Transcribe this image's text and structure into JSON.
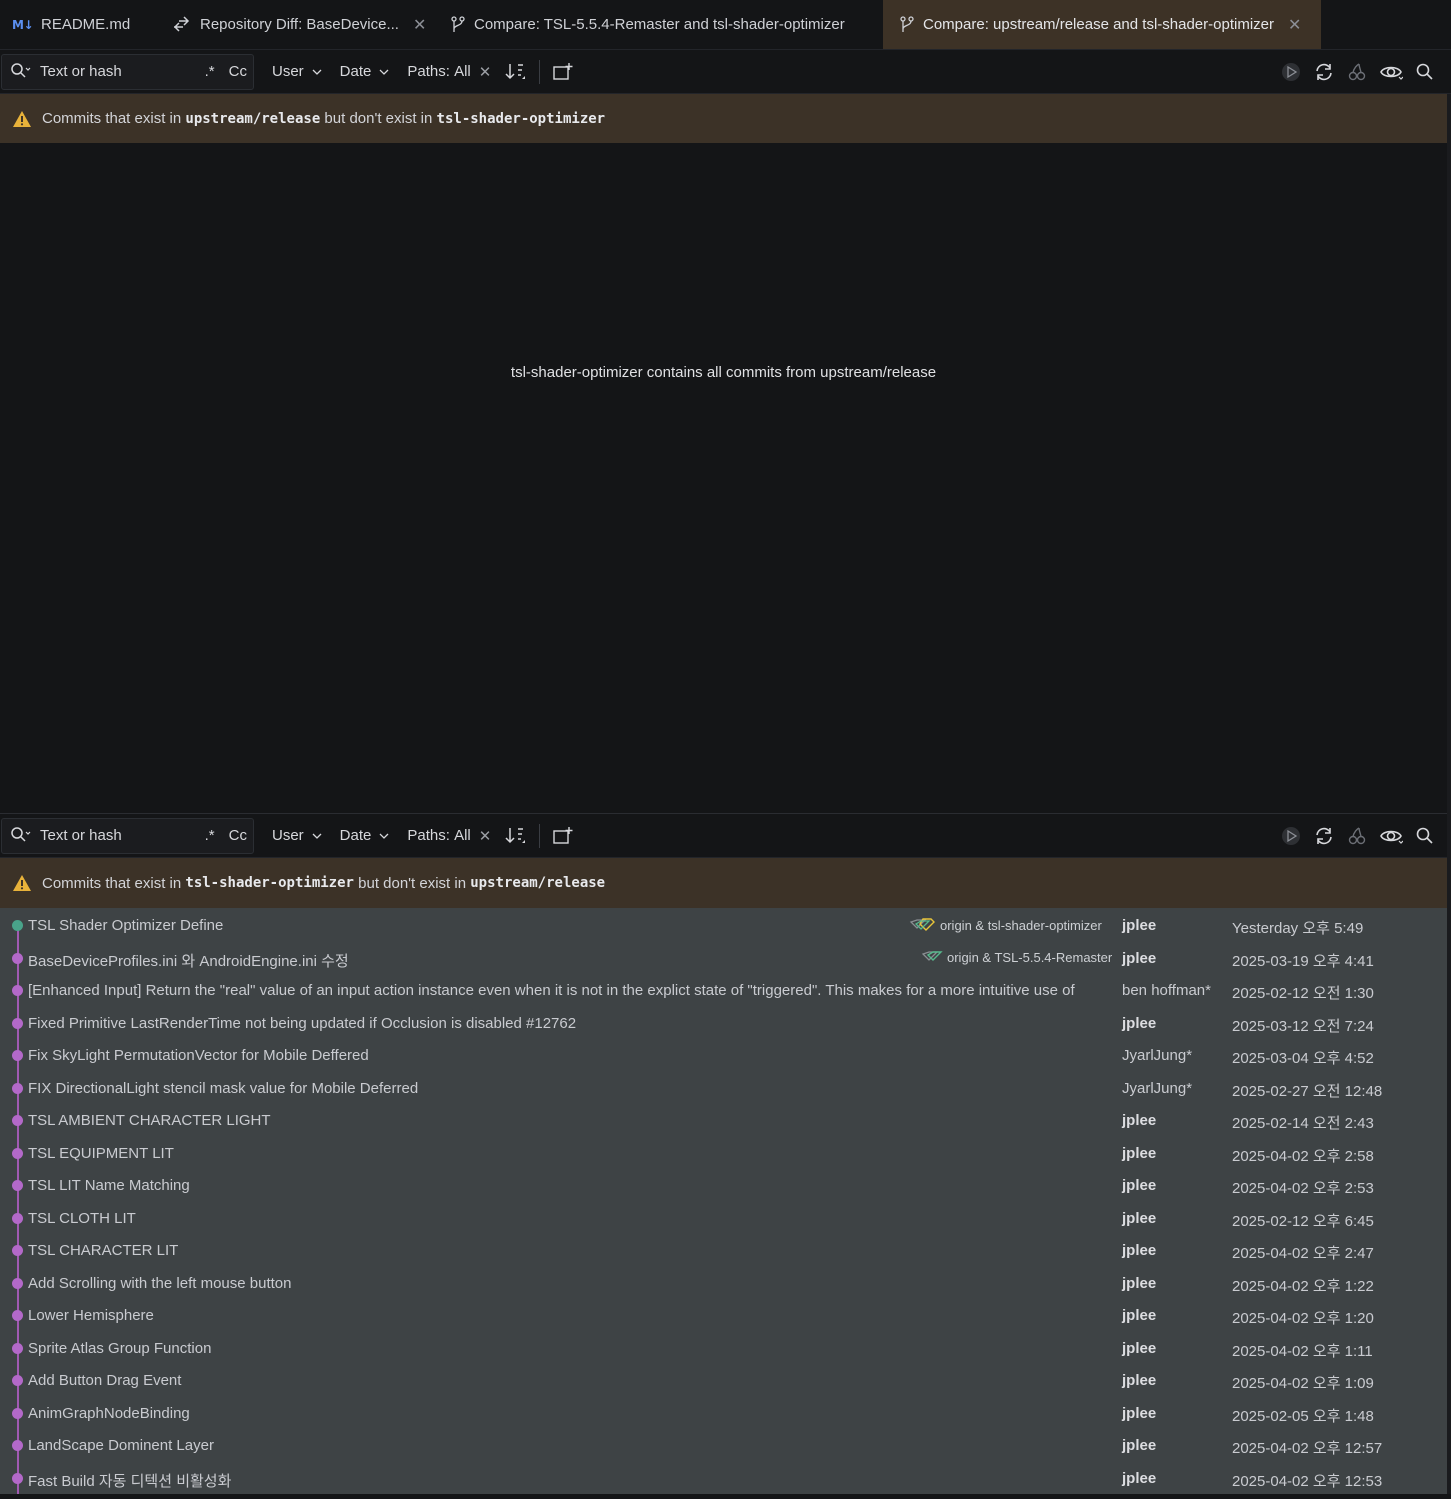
{
  "tabs": [
    {
      "label": "README.md",
      "icon": "markdown-icon",
      "closable": false,
      "active": false
    },
    {
      "label": "Repository Diff: BaseDevice...",
      "icon": "diff-icon",
      "closable": true,
      "active": false
    },
    {
      "label": "Compare: TSL-5.5.4-Remaster and tsl-shader-optimizer",
      "icon": "branch-icon",
      "closable": false,
      "active": false
    },
    {
      "label": "Compare: upstream/release and tsl-shader-optimizer",
      "icon": "branch-icon",
      "closable": true,
      "active": true
    }
  ],
  "markdown_badge": "M↓",
  "toolbar": {
    "search_placeholder": "Text or hash",
    "regex_label": ".*",
    "case_label": "Cc",
    "user_label": "User",
    "date_label": "Date",
    "paths_label": "Paths:",
    "paths_value": "All"
  },
  "top_panel": {
    "banner_prefix": "Commits that exist in",
    "banner_branch_a": "upstream/release",
    "banner_middle": "but don't exist in",
    "banner_branch_b": "tsl-shader-optimizer",
    "empty_message": "tsl-shader-optimizer contains all commits from upstream/release"
  },
  "bottom_panel": {
    "banner_prefix": "Commits that exist in",
    "banner_branch_a": "tsl-shader-optimizer",
    "banner_middle": "but don't exist in",
    "banner_branch_b": "upstream/release",
    "commits": [
      {
        "subject": "TSL Shader Optimizer Define",
        "refs": "origin & tsl-shader-optimizer",
        "author": "jplee",
        "date": "Yesterday 오후 5:49"
      },
      {
        "subject": "BaseDeviceProfiles.ini 와 AndroidEngine.ini 수정",
        "refs": "origin & TSL-5.5.4-Remaster",
        "author": "jplee",
        "date": "2025-03-19 오후 4:41"
      },
      {
        "subject": "[Enhanced Input] Return the \"real\" value of an input action instance even when it is not in the explict state of \"triggered\". This makes for a more intuitive use of",
        "refs": "",
        "author": "ben hoffman*",
        "date": "2025-02-12 오전 1:30"
      },
      {
        "subject": "Fixed Primitive LastRenderTime not being updated if Occlusion is disabled #12762",
        "refs": "",
        "author": "jplee",
        "date": "2025-03-12 오전 7:24"
      },
      {
        "subject": "Fix SkyLight PermutationVector for Mobile Deffered",
        "refs": "",
        "author": "JyarlJung*",
        "date": "2025-03-04 오후 4:52"
      },
      {
        "subject": "FIX DirectionalLight stencil mask value for Mobile Deferred",
        "refs": "",
        "author": "JyarlJung*",
        "date": "2025-02-27 오전 12:48"
      },
      {
        "subject": "TSL AMBIENT CHARACTER LIGHT",
        "refs": "",
        "author": "jplee",
        "date": "2025-02-14 오전 2:43"
      },
      {
        "subject": "TSL EQUIPMENT LIT",
        "refs": "",
        "author": "jplee",
        "date": "2025-04-02 오후 2:58"
      },
      {
        "subject": "TSL LIT Name Matching",
        "refs": "",
        "author": "jplee",
        "date": "2025-04-02 오후 2:53"
      },
      {
        "subject": "TSL CLOTH LIT",
        "refs": "",
        "author": "jplee",
        "date": "2025-02-12 오후 6:45"
      },
      {
        "subject": "TSL CHARACTER LIT",
        "refs": "",
        "author": "jplee",
        "date": "2025-04-02 오후 2:47"
      },
      {
        "subject": "Add Scrolling with the left mouse button",
        "refs": "",
        "author": "jplee",
        "date": "2025-04-02 오후 1:22"
      },
      {
        "subject": "Lower Hemisphere",
        "refs": "",
        "author": "jplee",
        "date": "2025-04-02 오후 1:20"
      },
      {
        "subject": "Sprite Atlas Group Function",
        "refs": "",
        "author": "jplee",
        "date": "2025-04-02 오후 1:11"
      },
      {
        "subject": "Add Button Drag Event",
        "refs": "",
        "author": "jplee",
        "date": "2025-04-02 오후 1:09"
      },
      {
        "subject": "AnimGraphNodeBinding",
        "refs": "",
        "author": "jplee",
        "date": "2025-02-05 오후 1:48"
      },
      {
        "subject": "LandScape Dominent Layer",
        "refs": "",
        "author": "jplee",
        "date": "2025-04-02 오후 12:57"
      },
      {
        "subject": "Fast Build 자동 디텍션 비활성화",
        "refs": "",
        "author": "jplee",
        "date": "2025-04-02 오후 12:53"
      }
    ]
  },
  "colors": {
    "accent_head_dot": "#49a38a",
    "graph_purple": "#b369c9",
    "banner_bg": "#3c3227",
    "warning_yellow": "#e8b23a"
  }
}
